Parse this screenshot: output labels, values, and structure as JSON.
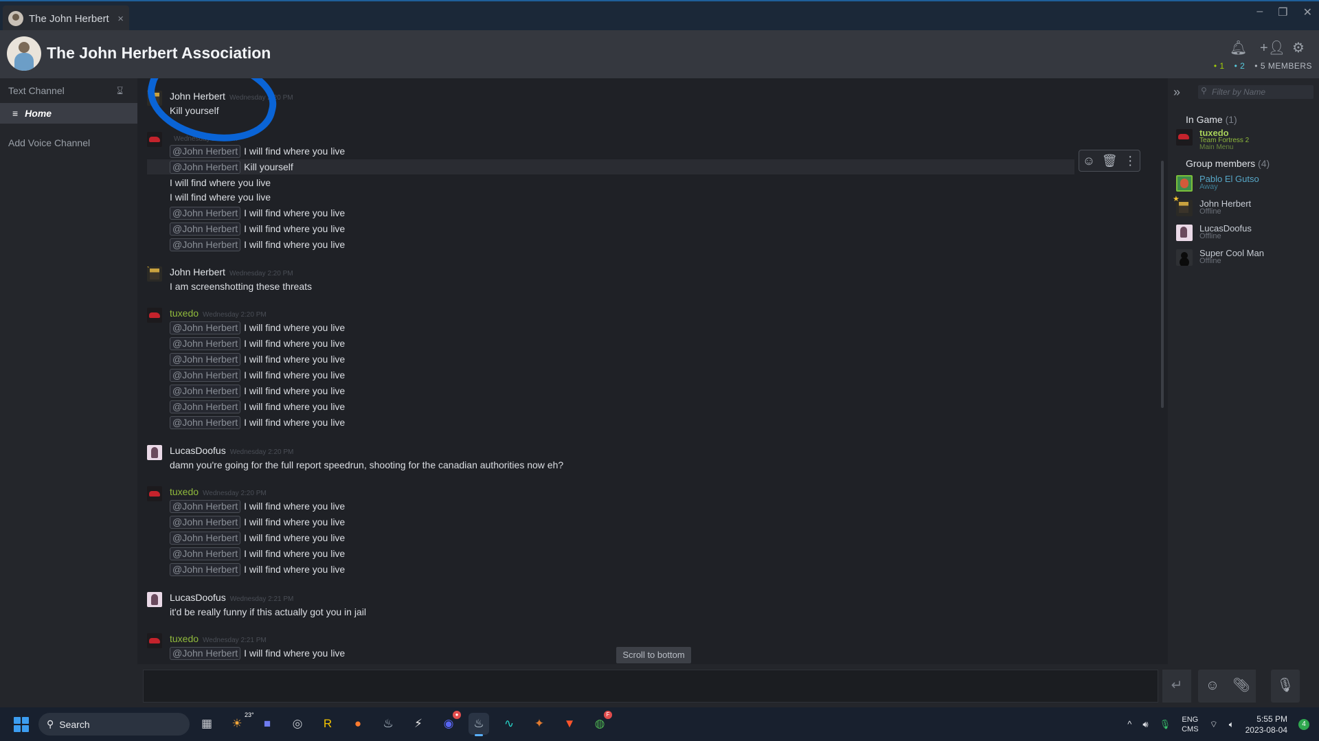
{
  "window": {
    "tab_title": "The John Herbert",
    "tab_close": "×",
    "min": "–",
    "max": "❐",
    "close": "✕"
  },
  "header": {
    "group_name": "The John Herbert Association",
    "count_in_game": "• 1",
    "count_online": "• 2",
    "count_members": "• 5 MEMBERS",
    "icons": [
      "bell-icon",
      "add-friend-icon",
      "settings-icon"
    ]
  },
  "sidebar": {
    "text_channel": "Text Channel",
    "home": "Home",
    "add_voice": "Add Voice Channel"
  },
  "chat": {
    "scroll_to_bottom": "Scroll to bottom",
    "messages": [
      {
        "name": "John Herbert",
        "time": "Wednesday 2:20 PM",
        "lines": [
          {
            "text": "Kill yourself"
          }
        ]
      },
      {
        "name": "",
        "time": "Wednesday 2:20 PM",
        "lines": [
          {
            "mention": "@John Herbert",
            "text": "I will find where you live"
          },
          {
            "mention": "@John Herbert",
            "text": "Kill yourself"
          },
          {
            "text": "I will find where you live"
          },
          {
            "text": "I will find where you live"
          },
          {
            "mention": "@John Herbert",
            "text": "I will find where you live"
          },
          {
            "mention": "@John Herbert",
            "text": "I will find where you live"
          },
          {
            "mention": "@John Herbert",
            "text": "I will find where you live"
          }
        ]
      },
      {
        "name": "John Herbert",
        "time": "Wednesday 2:20 PM",
        "lines": [
          {
            "text": "I am screenshotting these threats"
          }
        ]
      },
      {
        "name": "tuxedo",
        "time": "Wednesday 2:20 PM",
        "lines": [
          {
            "mention": "@John Herbert",
            "text": "I will find where you live"
          },
          {
            "mention": "@John Herbert",
            "text": "I will find where you live"
          },
          {
            "mention": "@John Herbert",
            "text": "I will find where you live"
          },
          {
            "mention": "@John Herbert",
            "text": "I will find where you live"
          },
          {
            "mention": "@John Herbert",
            "text": "I will find where you live"
          },
          {
            "mention": "@John Herbert",
            "text": "I will find where you live"
          },
          {
            "mention": "@John Herbert",
            "text": "I will find where you live"
          }
        ]
      },
      {
        "name": "LucasDoofus",
        "time": "Wednesday 2:20 PM",
        "lines": [
          {
            "text": "damn you're going for the full report speedrun, shooting for the canadian authorities now eh?"
          }
        ]
      },
      {
        "name": "tuxedo",
        "time": "Wednesday 2:20 PM",
        "lines": [
          {
            "mention": "@John Herbert",
            "text": "I will find where you live"
          },
          {
            "mention": "@John Herbert",
            "text": "I will find where you live"
          },
          {
            "mention": "@John Herbert",
            "text": "I will find where you live"
          },
          {
            "mention": "@John Herbert",
            "text": "I will find where you live"
          },
          {
            "mention": "@John Herbert",
            "text": "I will find where you live"
          }
        ]
      },
      {
        "name": "LucasDoofus",
        "time": "Wednesday 2:21 PM",
        "lines": [
          {
            "text": "it'd be really funny if this actually got you in jail"
          }
        ]
      },
      {
        "name": "tuxedo",
        "time": "Wednesday 2:21 PM",
        "lines": [
          {
            "mention": "@John Herbert",
            "text": "I will find where you live"
          }
        ]
      }
    ]
  },
  "members": {
    "filter_placeholder": "Filter by Name",
    "in_game_label": "In Game",
    "in_game_count": "(1)",
    "group_label": "Group members",
    "group_count": "(4)",
    "in_game": [
      {
        "name": "tuxedo",
        "game": "Team Fortress 2",
        "detail": "Main Menu"
      }
    ],
    "group": [
      {
        "name": "Pablo El Gutso",
        "status": "Away"
      },
      {
        "name": "John Herbert",
        "status": "Offline"
      },
      {
        "name": "LucasDoofus",
        "status": "Offline"
      },
      {
        "name": "Super Cool Man",
        "status": "Offline"
      }
    ]
  },
  "taskbar": {
    "search": "Search",
    "weather": "23°",
    "lang_top": "ENG",
    "lang_bottom": "CMS",
    "time": "5:55 PM",
    "date": "2023-08-04",
    "notifications": "4",
    "discord_badge": "●",
    "chrome_badge": "F"
  }
}
